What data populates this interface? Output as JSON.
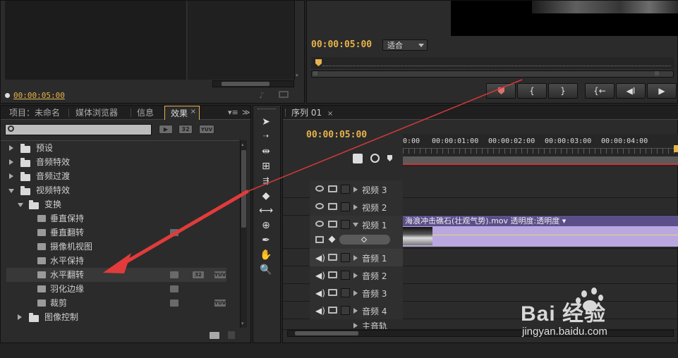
{
  "source_monitor": {
    "timecode": "00:00:05:00"
  },
  "program_monitor": {
    "timecode": "00:00:05:00",
    "fit_select": "适合",
    "buttons": [
      "{",
      "}",
      "{←",
      "◀I",
      "▶"
    ]
  },
  "project_panel": {
    "tabs": [
      {
        "label": "项目：未命名"
      },
      {
        "label": "媒体浏览器"
      },
      {
        "label": "信息"
      },
      {
        "label": "效果"
      }
    ],
    "search_placeholder": "",
    "filter_badges": [
      "32",
      "YUV"
    ],
    "tree": [
      {
        "label": "预设",
        "level": 0,
        "type": "folder",
        "expanded": false
      },
      {
        "label": "音频特效",
        "level": 0,
        "type": "folder",
        "expanded": false
      },
      {
        "label": "音频过渡",
        "level": 0,
        "type": "folder",
        "expanded": false
      },
      {
        "label": "视频特效",
        "level": 0,
        "type": "folder",
        "expanded": true
      },
      {
        "label": "变换",
        "level": 1,
        "type": "folder",
        "expanded": true
      },
      {
        "label": "垂直保持",
        "level": 2,
        "type": "effect"
      },
      {
        "label": "垂直翻转",
        "level": 2,
        "type": "effect"
      },
      {
        "label": "摄像机视图",
        "level": 2,
        "type": "effect"
      },
      {
        "label": "水平保持",
        "level": 2,
        "type": "effect"
      },
      {
        "label": "水平翻转",
        "level": 2,
        "type": "effect"
      },
      {
        "label": "羽化边缘",
        "level": 2,
        "type": "effect"
      },
      {
        "label": "裁剪",
        "level": 2,
        "type": "effect"
      },
      {
        "label": "图像控制",
        "level": 1,
        "type": "folder",
        "expanded": false
      }
    ]
  },
  "timeline": {
    "tab_label": "序列 01",
    "timecode": "00:00:05:00",
    "ruler_labels": [
      "0:00",
      "00:00:01:00",
      "00:00:02:00",
      "00:00:03:00",
      "00:00:04:00"
    ],
    "tracks": [
      {
        "label": "视频 3"
      },
      {
        "label": "视频 2"
      },
      {
        "label": "视频 1"
      },
      {
        "label": "音频 1"
      },
      {
        "label": "音频 2"
      },
      {
        "label": "音频 3"
      },
      {
        "label": "音频 4"
      },
      {
        "label": "主音轨"
      }
    ],
    "clip_label": "海浪冲击礁石(壮观气势).mov 透明度:透明度 ▾"
  },
  "watermark": {
    "brand": "Bai 经验",
    "url": "jingyan.baidu.com"
  },
  "colors": {
    "timecode": "#e8b34a",
    "clip": "#5b4f8a",
    "clip_body": "#b9a7e0",
    "arrow": "#e23b3b"
  }
}
